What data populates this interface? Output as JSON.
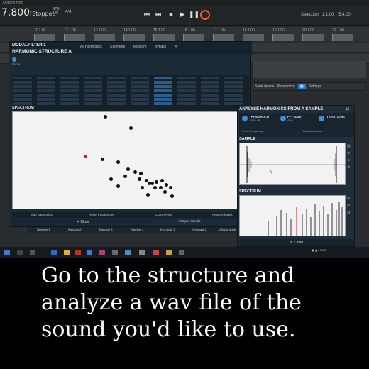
{
  "daw": {
    "menu_text": "Options  Help",
    "tempo": "7.800",
    "status": "[Stopped]",
    "bpm_label": "BPM",
    "bpm_value": "120",
    "time_sig": "4/4",
    "selection_label": "Selection",
    "selection_start": "1.1.00",
    "selection_end": "5.4.00",
    "ruler_marks": [
      "11.1.00",
      "12.1.00",
      "13.1.00",
      "14.1.00",
      "15.1.00",
      "16.1.00",
      "17.1.00",
      "18.1.00",
      "19.1.00",
      "20.1.00",
      "21.1.00"
    ]
  },
  "plugin": {
    "title": "MODALFILTER 1",
    "subtitle": "HARMONIC STRUCTURE A",
    "toolbar": [
      "All Harmonics",
      "Elements",
      "Random",
      "Bypass"
    ],
    "gain_label": "GAIN",
    "spectrum_label": "SPECTRUM",
    "bottom_actions": [
      "Map harmonics",
      "Reset frequencies",
      "Copy levels",
      "Restore levels"
    ],
    "analyze_sample": "Analyze sample",
    "close_label": "Close"
  },
  "track_bar": [
    "Random 1",
    "Random 2",
    "Random 3",
    "Random 4",
    "Key scale 1",
    "Key scale 2",
    "Velocity scale"
  ],
  "analyse": {
    "title": "ANALYSE HARMONICS FROM A SAMPLE",
    "threshold_label": "THRESHOLD",
    "threshold_value": "-60.00 dB",
    "fft_label": "FFT SIZE",
    "fft_value": "4096",
    "iterations_label": "ITERATIONS",
    "set_freq_label": "Set to frequency",
    "band_label": "Band information",
    "sample_label": "SAMPLE",
    "spectrum_label": "SPECTRUM",
    "close_label": "Close"
  },
  "right_toolbar": [
    "Save device",
    "Randomize",
    "Settings"
  ],
  "caption": {
    "line1": "Go to the structure and",
    "line2": "analyze a wav file of the",
    "line3": "sound you'd like to use."
  },
  "colors": {
    "accent_blue": "#2b5d8f",
    "record_orange": "#ff5a1a",
    "node_red": "#c0241c"
  }
}
